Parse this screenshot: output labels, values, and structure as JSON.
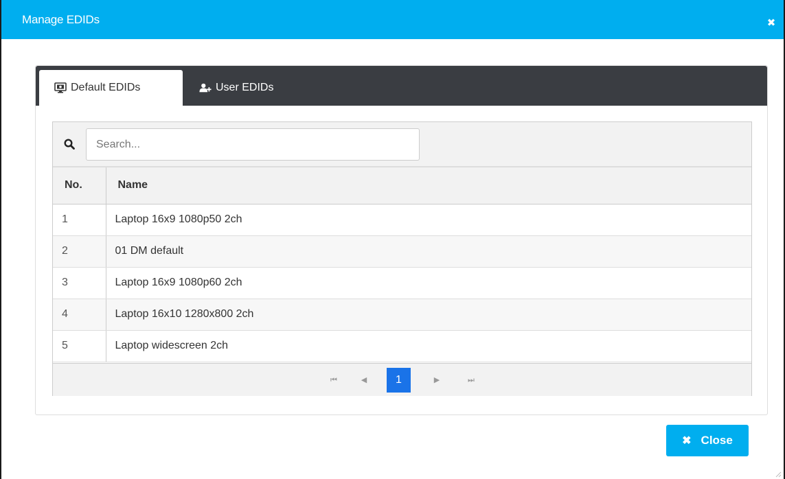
{
  "dialog": {
    "title": "Manage EDIDs",
    "close_glyph": "✖"
  },
  "tabs": [
    {
      "label": "Default EDIDs",
      "icon": "monitor-icon",
      "active": true
    },
    {
      "label": "User EDIDs",
      "icon": "add-user-icon",
      "active": false
    }
  ],
  "search": {
    "placeholder": "Search...",
    "value": ""
  },
  "table": {
    "columns": [
      "No.",
      "Name"
    ],
    "rows": [
      {
        "no": "1",
        "name": "Laptop 16x9 1080p50 2ch"
      },
      {
        "no": "2",
        "name": "01 DM default"
      },
      {
        "no": "3",
        "name": "Laptop 16x9 1080p60 2ch"
      },
      {
        "no": "4",
        "name": "Laptop 16x10 1280x800 2ch"
      },
      {
        "no": "5",
        "name": "Laptop widescreen 2ch"
      }
    ]
  },
  "pagination": {
    "current_page": "1",
    "first_glyph": "⏮",
    "prev_glyph": "◀",
    "next_glyph": "▶",
    "last_glyph": "⏭"
  },
  "footer": {
    "close_label": "Close",
    "close_glyph": "✖"
  },
  "colors": {
    "accent": "#00aeef",
    "page_active": "#1a73e8",
    "tabbar": "#3a3d42"
  }
}
